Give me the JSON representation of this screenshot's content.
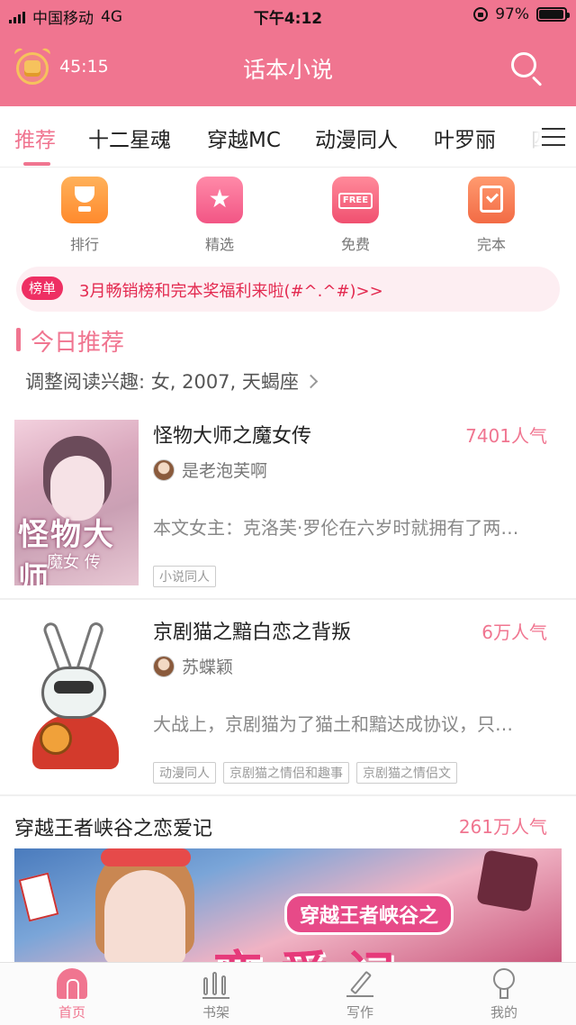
{
  "status_bar": {
    "carrier": "中国移动",
    "network": "4G",
    "time": "下午4:12",
    "battery": "97%",
    "battery_level": 0.97
  },
  "header": {
    "timer": "45:15",
    "title": "话本小说"
  },
  "tabs": [
    {
      "label": "推荐",
      "active": true
    },
    {
      "label": "十二星魂"
    },
    {
      "label": "穿越MC"
    },
    {
      "label": "动漫同人"
    },
    {
      "label": "叶罗丽"
    },
    {
      "label": "四"
    }
  ],
  "quick_links": [
    {
      "label": "排行",
      "icon": "trophy-icon",
      "color": "#ff9a3c"
    },
    {
      "label": "精选",
      "icon": "star-icon",
      "color": "#f25685"
    },
    {
      "label": "免费",
      "icon": "free-tag-icon",
      "color": "#f05070"
    },
    {
      "label": "完本",
      "icon": "checked-doc-icon",
      "color": "#f26b45"
    }
  ],
  "notice": {
    "badge": "榜单",
    "text": "3月畅销榜和完本奖福利来啦(#^.^#)>>"
  },
  "today": {
    "title": "今日推荐",
    "interest": "调整阅读兴趣: 女, 2007, 天蝎座"
  },
  "books": [
    {
      "title": "怪物大师之魔女传",
      "popularity": "7401人气",
      "author": "是老泡芙啊",
      "description": "本文女主：克洛芙·罗伦在六岁时就拥有了两…",
      "tags": [
        "小说同人"
      ],
      "cover_text": "怪物大师",
      "cover_subtext": "魔女 传"
    },
    {
      "title": "京剧猫之黯白恋之背叛",
      "popularity": "6万人气",
      "author": "苏蝶颖",
      "description": "大战上，京剧猫为了猫土和黯达成协议，只…",
      "tags": [
        "动漫同人",
        "京剧猫之情侣和趣事",
        "京剧猫之情侣文"
      ]
    }
  ],
  "featured": {
    "title": "穿越王者峡谷之恋爱记",
    "popularity": "261万人气",
    "banner_caption": "穿越王者峡谷之",
    "banner_big_text": "恋爱记"
  },
  "bottom_nav": [
    {
      "label": "首页",
      "icon": "home-icon",
      "active": true
    },
    {
      "label": "书架",
      "icon": "bookshelf-icon"
    },
    {
      "label": "写作",
      "icon": "pen-icon"
    },
    {
      "label": "我的",
      "icon": "profile-icon"
    }
  ],
  "colors": {
    "brand": "#f07590",
    "notice_text": "#e32a50",
    "badge": "#ee2f63"
  }
}
